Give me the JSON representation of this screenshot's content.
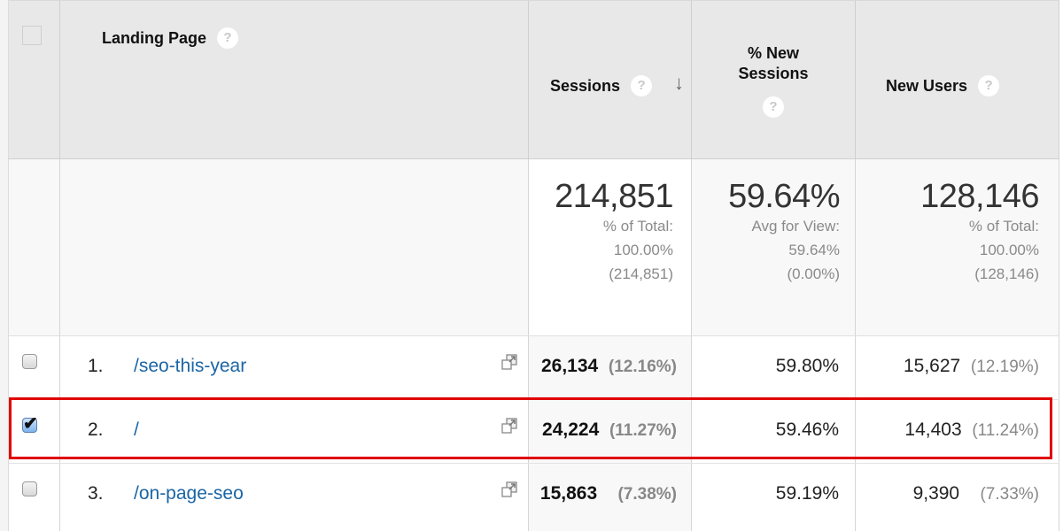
{
  "header": {
    "select_all_checked": false,
    "landing_page_label": "Landing Page",
    "sessions_label": "Sessions",
    "sort_icon": "arrow-down",
    "pct_new_sessions_label_line1": "% New",
    "pct_new_sessions_label_line2": "Sessions",
    "new_users_label": "New Users",
    "help_glyph": "?",
    "sort_glyph": "↓"
  },
  "summary": {
    "sessions": {
      "value": "214,851",
      "line1": "% of Total:",
      "line2": "100.00%",
      "line3": "(214,851)"
    },
    "pct_new_sessions": {
      "value": "59.64%",
      "line1": "Avg for View:",
      "line2": "59.64%",
      "line3": "(0.00%)"
    },
    "new_users": {
      "value": "128,146",
      "line1": "% of Total:",
      "line2": "100.00%",
      "line3": "(128,146)"
    }
  },
  "rows": [
    {
      "checked": false,
      "rank": "1.",
      "page": "/seo-this-year",
      "sessions": "26,134",
      "sessions_pct": "(12.16%)",
      "pct_new_sessions": "59.80%",
      "new_users": "15,627",
      "new_users_pct": "(12.19%)"
    },
    {
      "checked": true,
      "rank": "2.",
      "page": "/",
      "sessions": "24,224",
      "sessions_pct": "(11.27%)",
      "pct_new_sessions": "59.46%",
      "new_users": "14,403",
      "new_users_pct": "(11.24%)"
    },
    {
      "checked": false,
      "rank": "3.",
      "page": "/on-page-seo",
      "sessions": "15,863",
      "sessions_pct": "(7.38%)",
      "pct_new_sessions": "59.19%",
      "new_users": "9,390",
      "new_users_pct": "(7.33%)"
    }
  ],
  "highlight": {
    "row_index": 2,
    "color": "#e00000"
  },
  "colors": {
    "link": "#1a65a5",
    "header_bg": "#e8e8e8",
    "muted_text": "#888888"
  },
  "check_glyph": "✔"
}
